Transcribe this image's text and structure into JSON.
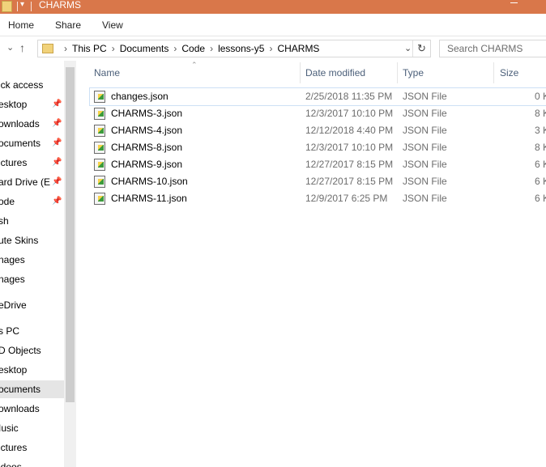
{
  "window": {
    "title": "CHARMS"
  },
  "ribbon": {
    "tabs": [
      "Home",
      "Share",
      "View"
    ]
  },
  "address": {
    "crumbs": [
      "This PC",
      "Documents",
      "Code",
      "lessons-y5",
      "CHARMS"
    ]
  },
  "search": {
    "placeholder": "Search CHARMS"
  },
  "sidebar": {
    "items": [
      {
        "label": "ick access",
        "pinned": false
      },
      {
        "label": "esktop",
        "pinned": true
      },
      {
        "label": "ownloads",
        "pinned": true
      },
      {
        "label": "ocuments",
        "pinned": true
      },
      {
        "label": "ictures",
        "pinned": true
      },
      {
        "label": "ard Drive (E",
        "pinned": true
      },
      {
        "label": "ode",
        "pinned": true
      },
      {
        "label": "sh",
        "pinned": false
      },
      {
        "label": "ute Skins",
        "pinned": false
      },
      {
        "label": "nages",
        "pinned": false
      },
      {
        "label": "nages",
        "pinned": false
      },
      {
        "label": "eDrive",
        "pinned": false
      },
      {
        "label": "s PC",
        "pinned": false
      },
      {
        "label": "D Objects",
        "pinned": false
      },
      {
        "label": "esktop",
        "pinned": false
      },
      {
        "label": "ocuments",
        "pinned": false,
        "selected": true
      },
      {
        "label": "ownloads",
        "pinned": false
      },
      {
        "label": "Iusic",
        "pinned": false
      },
      {
        "label": "ictures",
        "pinned": false
      },
      {
        "label": "ideos",
        "pinned": false
      }
    ]
  },
  "columns": {
    "name": "Name",
    "date": "Date modified",
    "type": "Type",
    "size": "Size"
  },
  "files": [
    {
      "name": "changes.json",
      "date": "2/25/2018 11:35 PM",
      "type": "JSON File",
      "size": "0 K"
    },
    {
      "name": "CHARMS-3.json",
      "date": "12/3/2017 10:10 PM",
      "type": "JSON File",
      "size": "8 K"
    },
    {
      "name": "CHARMS-4.json",
      "date": "12/12/2018 4:40 PM",
      "type": "JSON File",
      "size": "3 K"
    },
    {
      "name": "CHARMS-8.json",
      "date": "12/3/2017 10:10 PM",
      "type": "JSON File",
      "size": "8 K"
    },
    {
      "name": "CHARMS-9.json",
      "date": "12/27/2017 8:15 PM",
      "type": "JSON File",
      "size": "6 K"
    },
    {
      "name": "CHARMS-10.json",
      "date": "12/27/2017 8:15 PM",
      "type": "JSON File",
      "size": "6 K"
    },
    {
      "name": "CHARMS-11.json",
      "date": "12/9/2017 6:25 PM",
      "type": "JSON File",
      "size": "6 K"
    }
  ],
  "colors": {
    "titlebar": "#d9774a",
    "selected": "#e5e5e5",
    "header_text": "#4c607a"
  }
}
